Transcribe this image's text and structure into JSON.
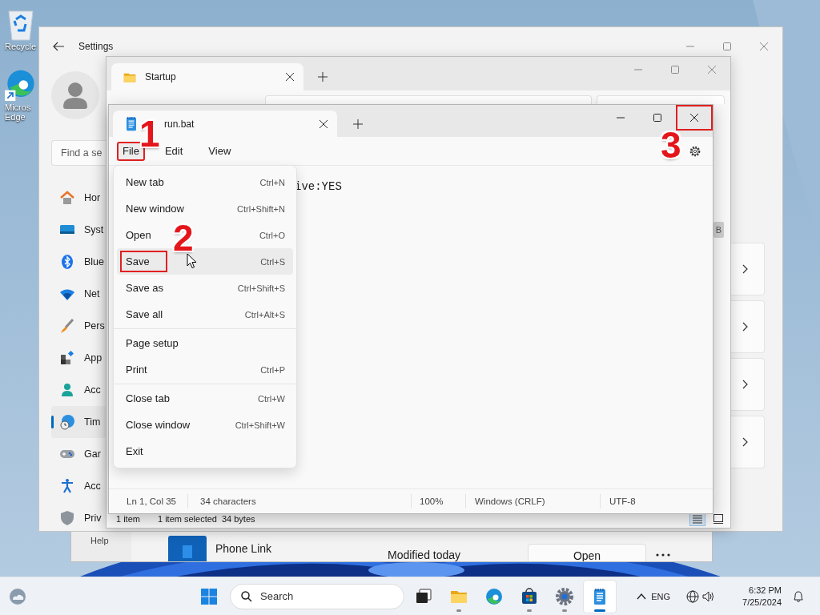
{
  "desktop_icons": [
    {
      "kind": "recycle-bin",
      "label_lines": [
        "Recycle"
      ]
    },
    {
      "kind": "edge",
      "label_lines": [
        "Micros",
        "Edge"
      ]
    }
  ],
  "background_window": {
    "pane_label": "Help",
    "row": {
      "name": "Phone Link",
      "modified": "Modified today",
      "action": "Open"
    }
  },
  "settings_window": {
    "title": "Settings",
    "search": {
      "placeholder": "Find a se"
    },
    "nav_items": [
      {
        "kind": "home",
        "label": "Hor",
        "selected": false
      },
      {
        "kind": "system",
        "label": "Syst",
        "selected": false
      },
      {
        "kind": "bluetooth",
        "label": "Blue",
        "selected": false
      },
      {
        "kind": "network",
        "label": "Net",
        "selected": false
      },
      {
        "kind": "personalization",
        "label": "Pers",
        "selected": false
      },
      {
        "kind": "apps",
        "label": "App",
        "selected": false
      },
      {
        "kind": "accounts",
        "label": "Acc",
        "selected": false
      },
      {
        "kind": "time",
        "label": "Tim",
        "selected": true
      },
      {
        "kind": "gaming",
        "label": "Gar",
        "selected": false
      },
      {
        "kind": "accessibility",
        "label": "Acc",
        "selected": false
      },
      {
        "kind": "privacy",
        "label": "Priv",
        "selected": false
      }
    ]
  },
  "explorer_window": {
    "tab": {
      "title": "Startup"
    },
    "badge": "B",
    "status_bar": [
      "1 item",
      "1 item selected",
      "34 bytes"
    ]
  },
  "notepad_window": {
    "tab": {
      "title": "run.bat"
    },
    "window_controls": [
      {
        "kind": "minimize",
        "annotated": false
      },
      {
        "kind": "maximize",
        "annotated": false
      },
      {
        "kind": "close",
        "annotated": true
      }
    ],
    "menus": [
      {
        "label": "File",
        "selected": true,
        "annotated": true
      },
      {
        "label": "Edit",
        "selected": false,
        "annotated": false
      },
      {
        "label": "View",
        "selected": false,
        "annotated": false
      }
    ],
    "editor_text": "ive:YES",
    "file_menu": [
      {
        "kind": "item",
        "label": "New tab",
        "shortcut": "Ctrl+N",
        "selected": false,
        "annotated": false
      },
      {
        "kind": "item",
        "label": "New window",
        "shortcut": "Ctrl+Shift+N",
        "selected": false,
        "annotated": false
      },
      {
        "kind": "item",
        "label": "Open",
        "shortcut": "Ctrl+O",
        "selected": false,
        "annotated": false
      },
      {
        "kind": "item",
        "label": "Save",
        "shortcut": "Ctrl+S",
        "selected": true,
        "annotated": true
      },
      {
        "kind": "item",
        "label": "Save as",
        "shortcut": "Ctrl+Shift+S",
        "selected": false,
        "annotated": false
      },
      {
        "kind": "item",
        "label": "Save all",
        "shortcut": "Ctrl+Alt+S",
        "selected": false,
        "annotated": false
      },
      {
        "kind": "separator"
      },
      {
        "kind": "item",
        "label": "Page setup",
        "selected": false,
        "annotated": false
      },
      {
        "kind": "item",
        "label": "Print",
        "shortcut": "Ctrl+P",
        "selected": false,
        "annotated": false
      },
      {
        "kind": "separator"
      },
      {
        "kind": "item",
        "label": "Close tab",
        "shortcut": "Ctrl+W",
        "selected": false,
        "annotated": false
      },
      {
        "kind": "item",
        "label": "Close window",
        "shortcut": "Ctrl+Shift+W",
        "selected": false,
        "annotated": false
      },
      {
        "kind": "item",
        "label": "Exit",
        "selected": false,
        "annotated": false
      }
    ],
    "status_bar": [
      "Ln 1, Col 35",
      "34 characters",
      "100%",
      "Windows (CRLF)",
      "UTF-8"
    ]
  },
  "annotations": [
    {
      "label": "1"
    },
    {
      "label": "2"
    },
    {
      "label": "3"
    }
  ],
  "taskbar": {
    "search": {
      "placeholder": "Search"
    },
    "apps": [
      {
        "kind": "task-view",
        "running": false,
        "active": false
      },
      {
        "kind": "explorer",
        "running": true,
        "active": false
      },
      {
        "kind": "edge",
        "running": false,
        "active": false
      },
      {
        "kind": "store",
        "running": true,
        "active": false
      },
      {
        "kind": "settings",
        "running": true,
        "active": false
      },
      {
        "kind": "notepad",
        "running": true,
        "active": true
      }
    ],
    "language": "ENG",
    "time": "6:32 PM",
    "date": "7/25/2024"
  }
}
